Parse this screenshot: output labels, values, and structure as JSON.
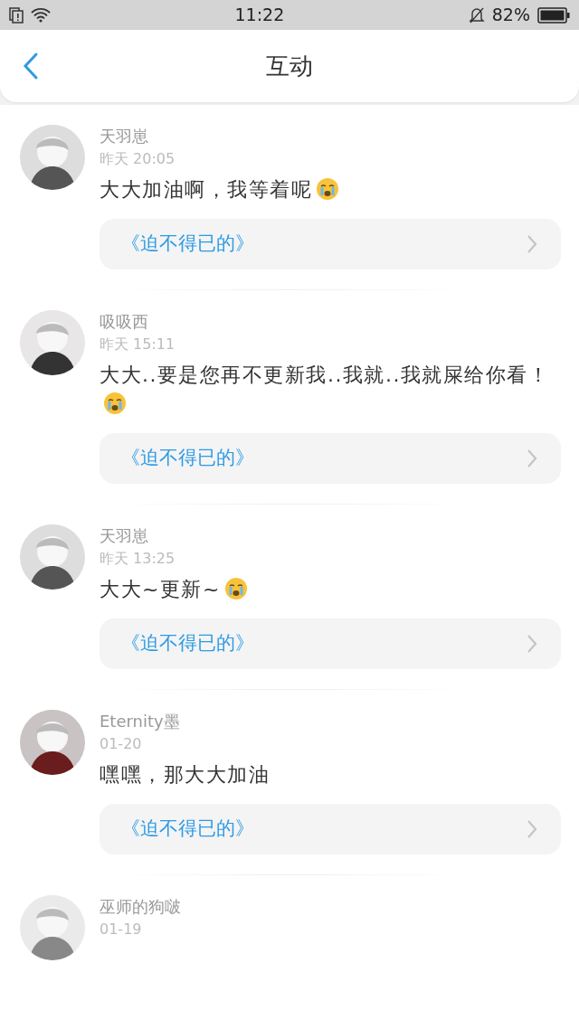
{
  "status_bar": {
    "time": "11:22",
    "battery": "82%"
  },
  "header": {
    "title": "互动"
  },
  "comments": [
    {
      "user": "天羽崽",
      "time": "昨天 20:05",
      "text": "大大加油啊，我等着呢",
      "emoji": true,
      "work": "《迫不得已的》"
    },
    {
      "user": "吸吸西",
      "time": "昨天 15:11",
      "text": "大大..要是您再不更新我..我就..我就屎给你看！",
      "emoji": true,
      "work": "《迫不得已的》"
    },
    {
      "user": "天羽崽",
      "time": "昨天 13:25",
      "text": "大大~更新~",
      "emoji": true,
      "work": "《迫不得已的》"
    },
    {
      "user": "Eternity墨",
      "time": "01-20",
      "text": "嘿嘿，那大大加油",
      "emoji": false,
      "work": "《迫不得已的》"
    },
    {
      "user": "巫师的狗啵",
      "time": "01-19"
    }
  ]
}
